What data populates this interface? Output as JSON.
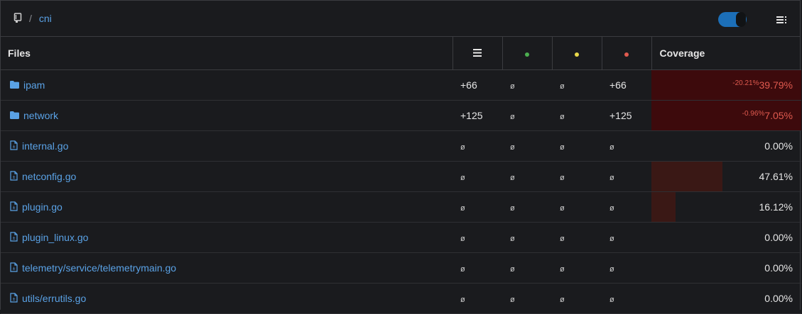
{
  "breadcrumb": {
    "separator": "/",
    "current": "cni",
    "icon": "repo-icon"
  },
  "toolbar": {
    "toggle_state": "on",
    "menu_icon": "list-settings-icon"
  },
  "colors": {
    "green": "#4caf50",
    "yellow": "#e8d84a",
    "red": "#e05a4f",
    "link": "#5aa2e6",
    "toggle": "#1c6fb8",
    "low_coverage_fill": "#3d0a0c",
    "partial_fill": "#3a1815"
  },
  "table": {
    "headers": {
      "files": "Files",
      "lines_icon": "menu-lines-icon",
      "covered_icon": "green-dot",
      "partial_icon": "yellow-dot",
      "missed_icon": "red-dot",
      "coverage": "Coverage"
    },
    "rows": [
      {
        "type": "folder",
        "name": "ipam",
        "total": "+66",
        "covered": "ø",
        "partial": "ø",
        "missed": "+66",
        "delta": "-20.21%",
        "coverage": "39.79%",
        "coverage_value": 39.79,
        "bar": "full-red"
      },
      {
        "type": "folder",
        "name": "network",
        "total": "+125",
        "covered": "ø",
        "partial": "ø",
        "missed": "+125",
        "delta": "-0.96%",
        "coverage": "7.05%",
        "coverage_value": 7.05,
        "bar": "full-red"
      },
      {
        "type": "file",
        "name": "internal.go",
        "total": "ø",
        "covered": "ø",
        "partial": "ø",
        "missed": "ø",
        "delta": "",
        "coverage": "0.00%",
        "coverage_value": 0,
        "bar": "none"
      },
      {
        "type": "file",
        "name": "netconfig.go",
        "total": "ø",
        "covered": "ø",
        "partial": "ø",
        "missed": "ø",
        "delta": "",
        "coverage": "47.61%",
        "coverage_value": 47.61,
        "bar": "partial"
      },
      {
        "type": "file",
        "name": "plugin.go",
        "total": "ø",
        "covered": "ø",
        "partial": "ø",
        "missed": "ø",
        "delta": "",
        "coverage": "16.12%",
        "coverage_value": 16.12,
        "bar": "partial"
      },
      {
        "type": "file",
        "name": "plugin_linux.go",
        "total": "ø",
        "covered": "ø",
        "partial": "ø",
        "missed": "ø",
        "delta": "",
        "coverage": "0.00%",
        "coverage_value": 0,
        "bar": "none"
      },
      {
        "type": "file",
        "name": "telemetry/service/telemetrymain.go",
        "total": "ø",
        "covered": "ø",
        "partial": "ø",
        "missed": "ø",
        "delta": "",
        "coverage": "0.00%",
        "coverage_value": 0,
        "bar": "none"
      },
      {
        "type": "file",
        "name": "utils/errutils.go",
        "total": "ø",
        "covered": "ø",
        "partial": "ø",
        "missed": "ø",
        "delta": "",
        "coverage": "0.00%",
        "coverage_value": 0,
        "bar": "none"
      }
    ]
  }
}
